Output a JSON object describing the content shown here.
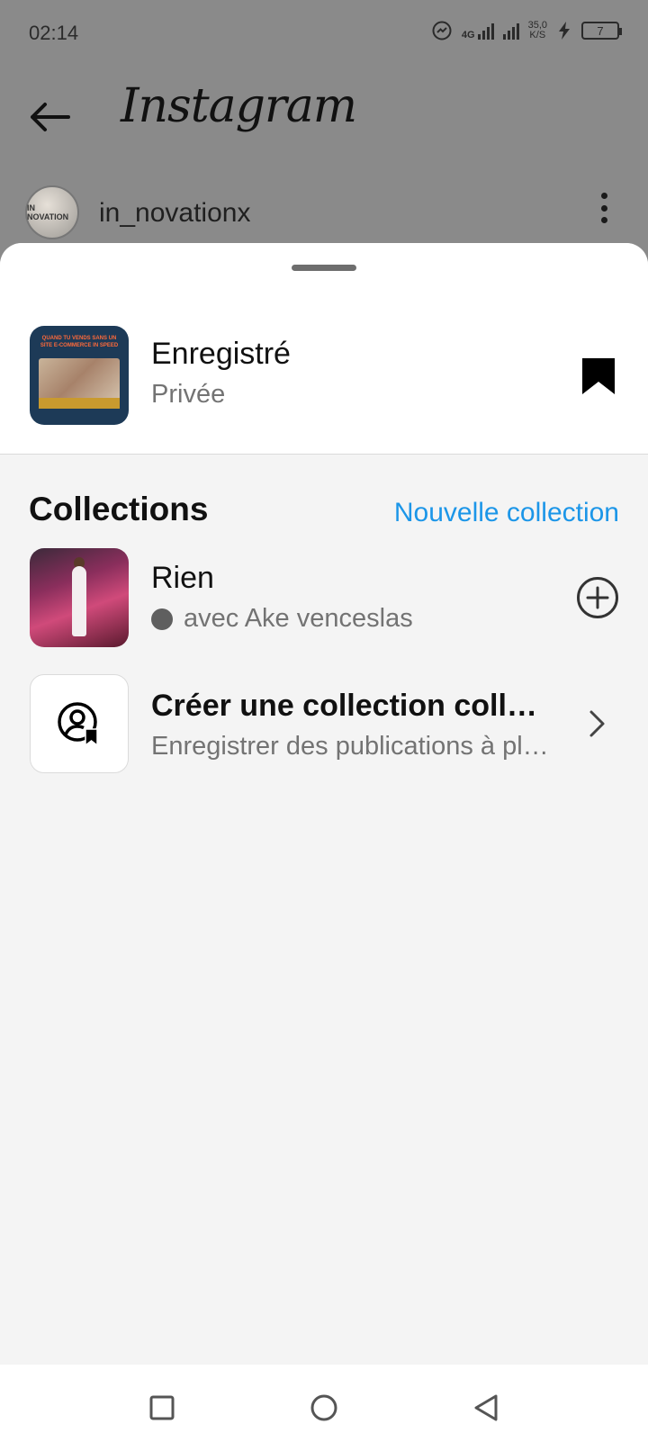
{
  "status_bar": {
    "time": "02:14",
    "network_label": "4G",
    "speed_value": "35,0",
    "speed_unit": "K/S",
    "battery_level": "7"
  },
  "app_header": {
    "logo_text": "Instagram"
  },
  "profile": {
    "username": "in_novationx",
    "avatar_text": "IN NOVATION"
  },
  "saved": {
    "title": "Enregistré",
    "subtitle": "Privée",
    "thumb_caption": "QUAND TU VENDS SANS UN SITE E-COMMERCE IN SPEED"
  },
  "collections": {
    "heading": "Collections",
    "new_collection_label": "Nouvelle collection",
    "items": [
      {
        "title": "Rien",
        "subtitle": "avec Ake venceslas"
      }
    ],
    "collab": {
      "title": "Créer une collection collaborative",
      "subtitle": "Enregistrer des publications à plusieurs"
    }
  },
  "colors": {
    "accent_blue": "#1c96e8",
    "dim_overlay": "#8a8a8a",
    "sheet_bg": "#f4f4f4"
  },
  "icons": [
    "back-arrow-icon",
    "more-vertical-icon",
    "bookmark-filled-icon",
    "plus-circle-icon",
    "collab-user-bookmark-icon",
    "chevron-right-icon",
    "nav-recent-icon",
    "nav-home-icon",
    "nav-back-icon"
  ]
}
